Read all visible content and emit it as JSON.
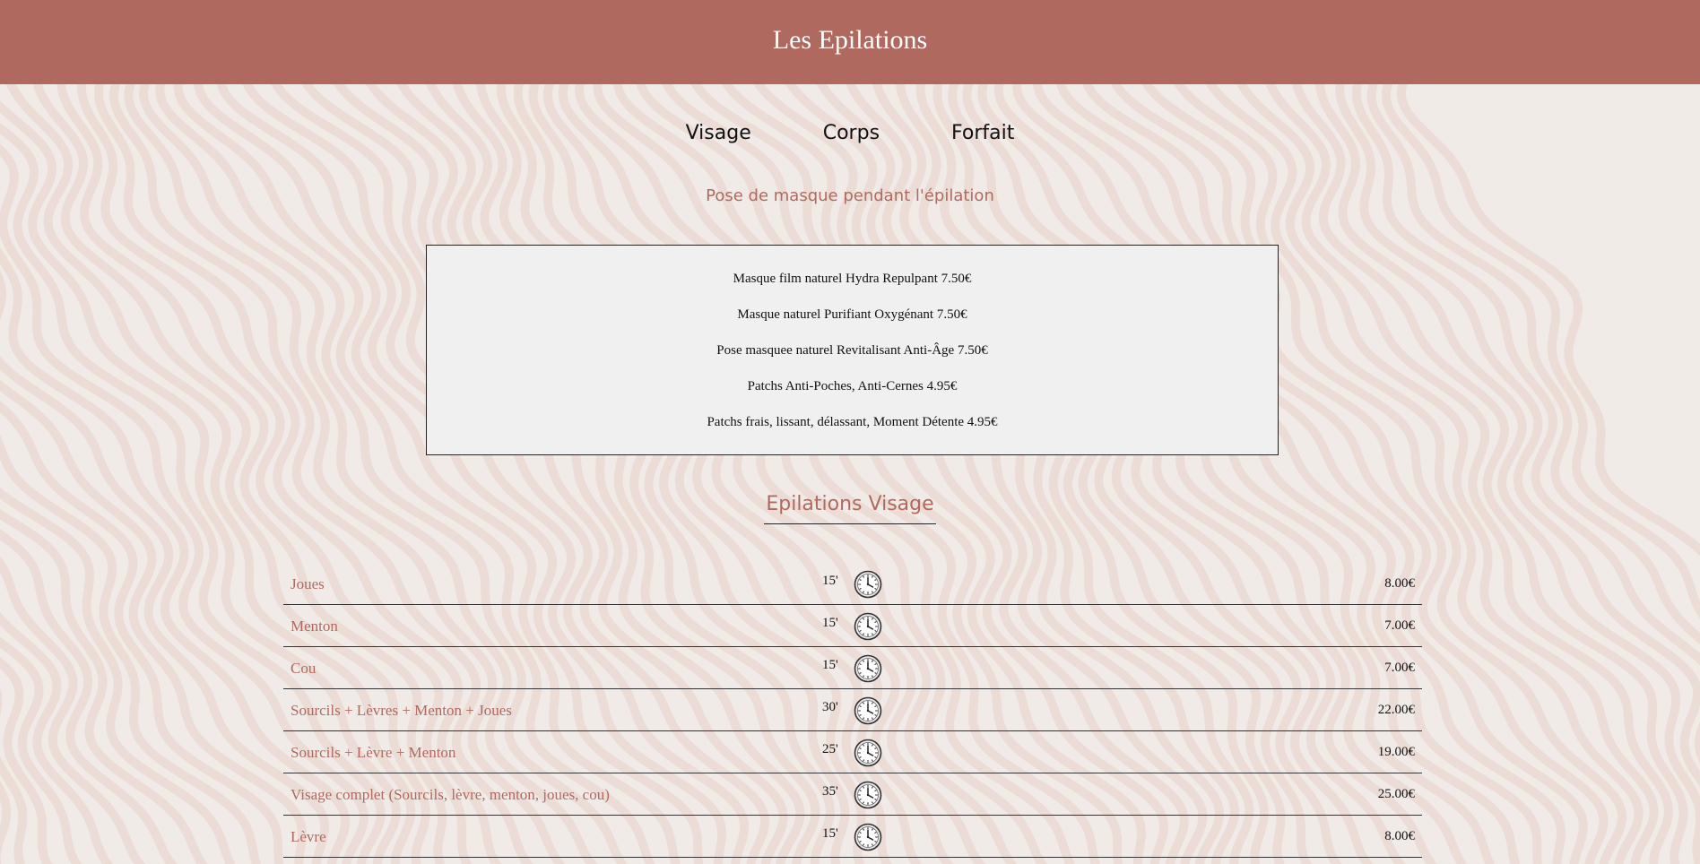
{
  "header": {
    "title": "Les Epilations"
  },
  "nav": {
    "items": [
      {
        "label": "Visage"
      },
      {
        "label": "Corps"
      },
      {
        "label": "Forfait"
      }
    ]
  },
  "masks": {
    "subtitle": "Pose de masque pendant l'épilation",
    "items": [
      "Masque film naturel Hydra Repulpant 7.50€",
      "Masque naturel Purifiant Oxygénant 7.50€",
      "Pose masquee naturel Revitalisant Anti-Âge 7.50€",
      "Patchs Anti-Poches, Anti-Cernes 4.95€",
      "Patchs frais, lissant, délassant, Moment Détente 4.95€"
    ]
  },
  "visage": {
    "title": "Epilations Visage",
    "clock_icon": "clock-icon",
    "rows": [
      {
        "name": "Joues",
        "duration": "15'",
        "price": "8.00€"
      },
      {
        "name": "Menton",
        "duration": "15'",
        "price": "7.00€"
      },
      {
        "name": "Cou",
        "duration": "15'",
        "price": "7.00€"
      },
      {
        "name": "Sourcils + Lèvres + Menton + Joues",
        "duration": "30'",
        "price": "22.00€"
      },
      {
        "name": "Sourcils + Lèvre + Menton",
        "duration": "25'",
        "price": "19.00€"
      },
      {
        "name": "Visage complet (Sourcils, lèvre, menton, joues, cou)",
        "duration": "35'",
        "price": "25.00€"
      },
      {
        "name": "Lèvre",
        "duration": "15'",
        "price": "8.00€"
      }
    ]
  },
  "colors": {
    "header_bg": "#b0695f",
    "accent_text": "#b0695f",
    "page_bg": "#f1ebe8",
    "wave_stroke": "#eadbd3",
    "mask_box_bg": "#f0f0f0"
  }
}
